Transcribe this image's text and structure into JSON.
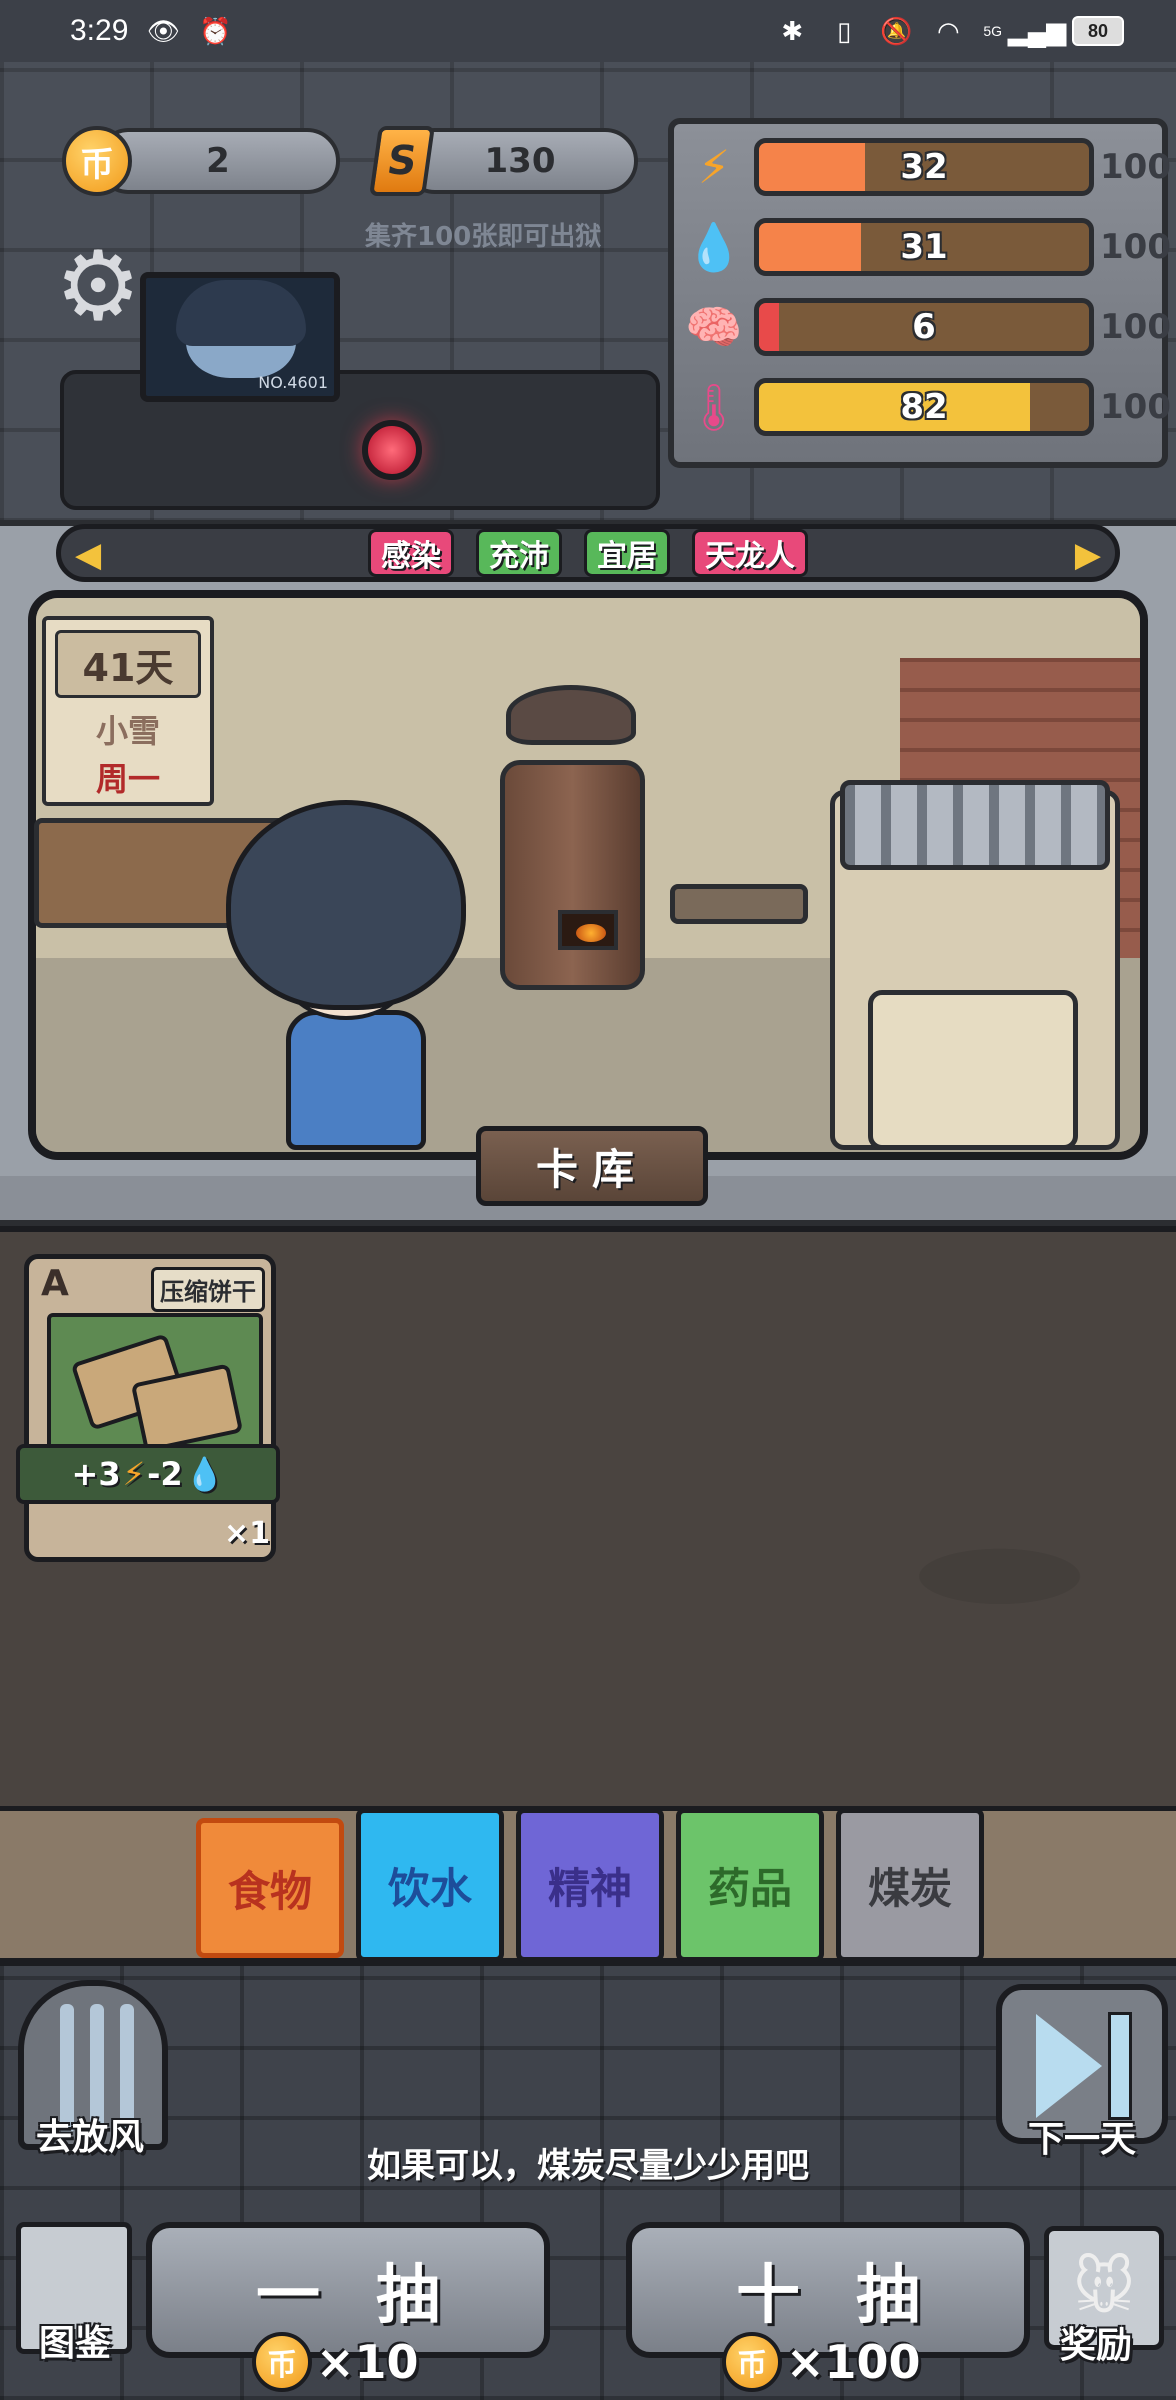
{
  "status_bar": {
    "time": "3:29",
    "network": "5G",
    "battery": "80",
    "left_icons": [
      "eye-icon",
      "alarm-icon"
    ],
    "right_icons": [
      "bluetooth-icon",
      "vibrate-icon",
      "mute-icon",
      "wifi-icon",
      "signal-icon"
    ]
  },
  "resources": {
    "coin_symbol": "币",
    "coins": "2",
    "card_symbol": "S",
    "cards": "130",
    "hint": "集齐100张即可出狱"
  },
  "monitor": {
    "id": "NO.4601"
  },
  "stats": [
    {
      "icon": "energy-bolt-icon",
      "glyph": "⚡",
      "value": "32",
      "max": "100",
      "level": 0.32,
      "color": "#f5834a"
    },
    {
      "icon": "water-drop-icon",
      "glyph": "💧",
      "value": "31",
      "max": "100",
      "level": 0.31,
      "color": "#f5834a"
    },
    {
      "icon": "brain-icon",
      "glyph": "🧠",
      "value": "6",
      "max": "100",
      "level": 0.06,
      "color": "#e84a4a"
    },
    {
      "icon": "thermometer-icon",
      "glyph": "🌡",
      "value": "82",
      "max": "100",
      "level": 0.82,
      "color": "#f3c23c"
    }
  ],
  "tags": [
    {
      "label": "感染",
      "color": "#e8497a"
    },
    {
      "label": "充沛",
      "color": "#58b85a"
    },
    {
      "label": "宜居",
      "color": "#58b85a"
    },
    {
      "label": "天龙人",
      "color": "#e8497a"
    }
  ],
  "calendar": {
    "day": "41天",
    "weather": "小雪",
    "weekday": "周一"
  },
  "card_library_label": "卡库",
  "cards": [
    {
      "grade": "A",
      "name": "压缩饼干",
      "effect_plus": "+3",
      "effect_minus": "-2",
      "count": "×1"
    }
  ],
  "categories": [
    {
      "label": "食物",
      "bg": "#f08a3a",
      "fg": "#b8321f",
      "selected": true
    },
    {
      "label": "饮水",
      "bg": "#2fb8f0",
      "fg": "#1d4d9a",
      "selected": false
    },
    {
      "label": "精神",
      "bg": "#6f66d6",
      "fg": "#3a2f8a",
      "selected": false
    },
    {
      "label": "药品",
      "bg": "#6cc46a",
      "fg": "#2d6a2a",
      "selected": false
    },
    {
      "label": "煤炭",
      "bg": "#9a9aa2",
      "fg": "#3a3b40",
      "selected": false
    }
  ],
  "actions": {
    "yard": "去放风",
    "next_day": "下一天",
    "tip": "如果可以，煤炭尽量少少用吧",
    "codex": "图鉴",
    "draw_one": "一抽",
    "draw_one_cost": "×10",
    "draw_ten": "十抽",
    "draw_ten_cost": "×100",
    "rewards": "奖励"
  }
}
